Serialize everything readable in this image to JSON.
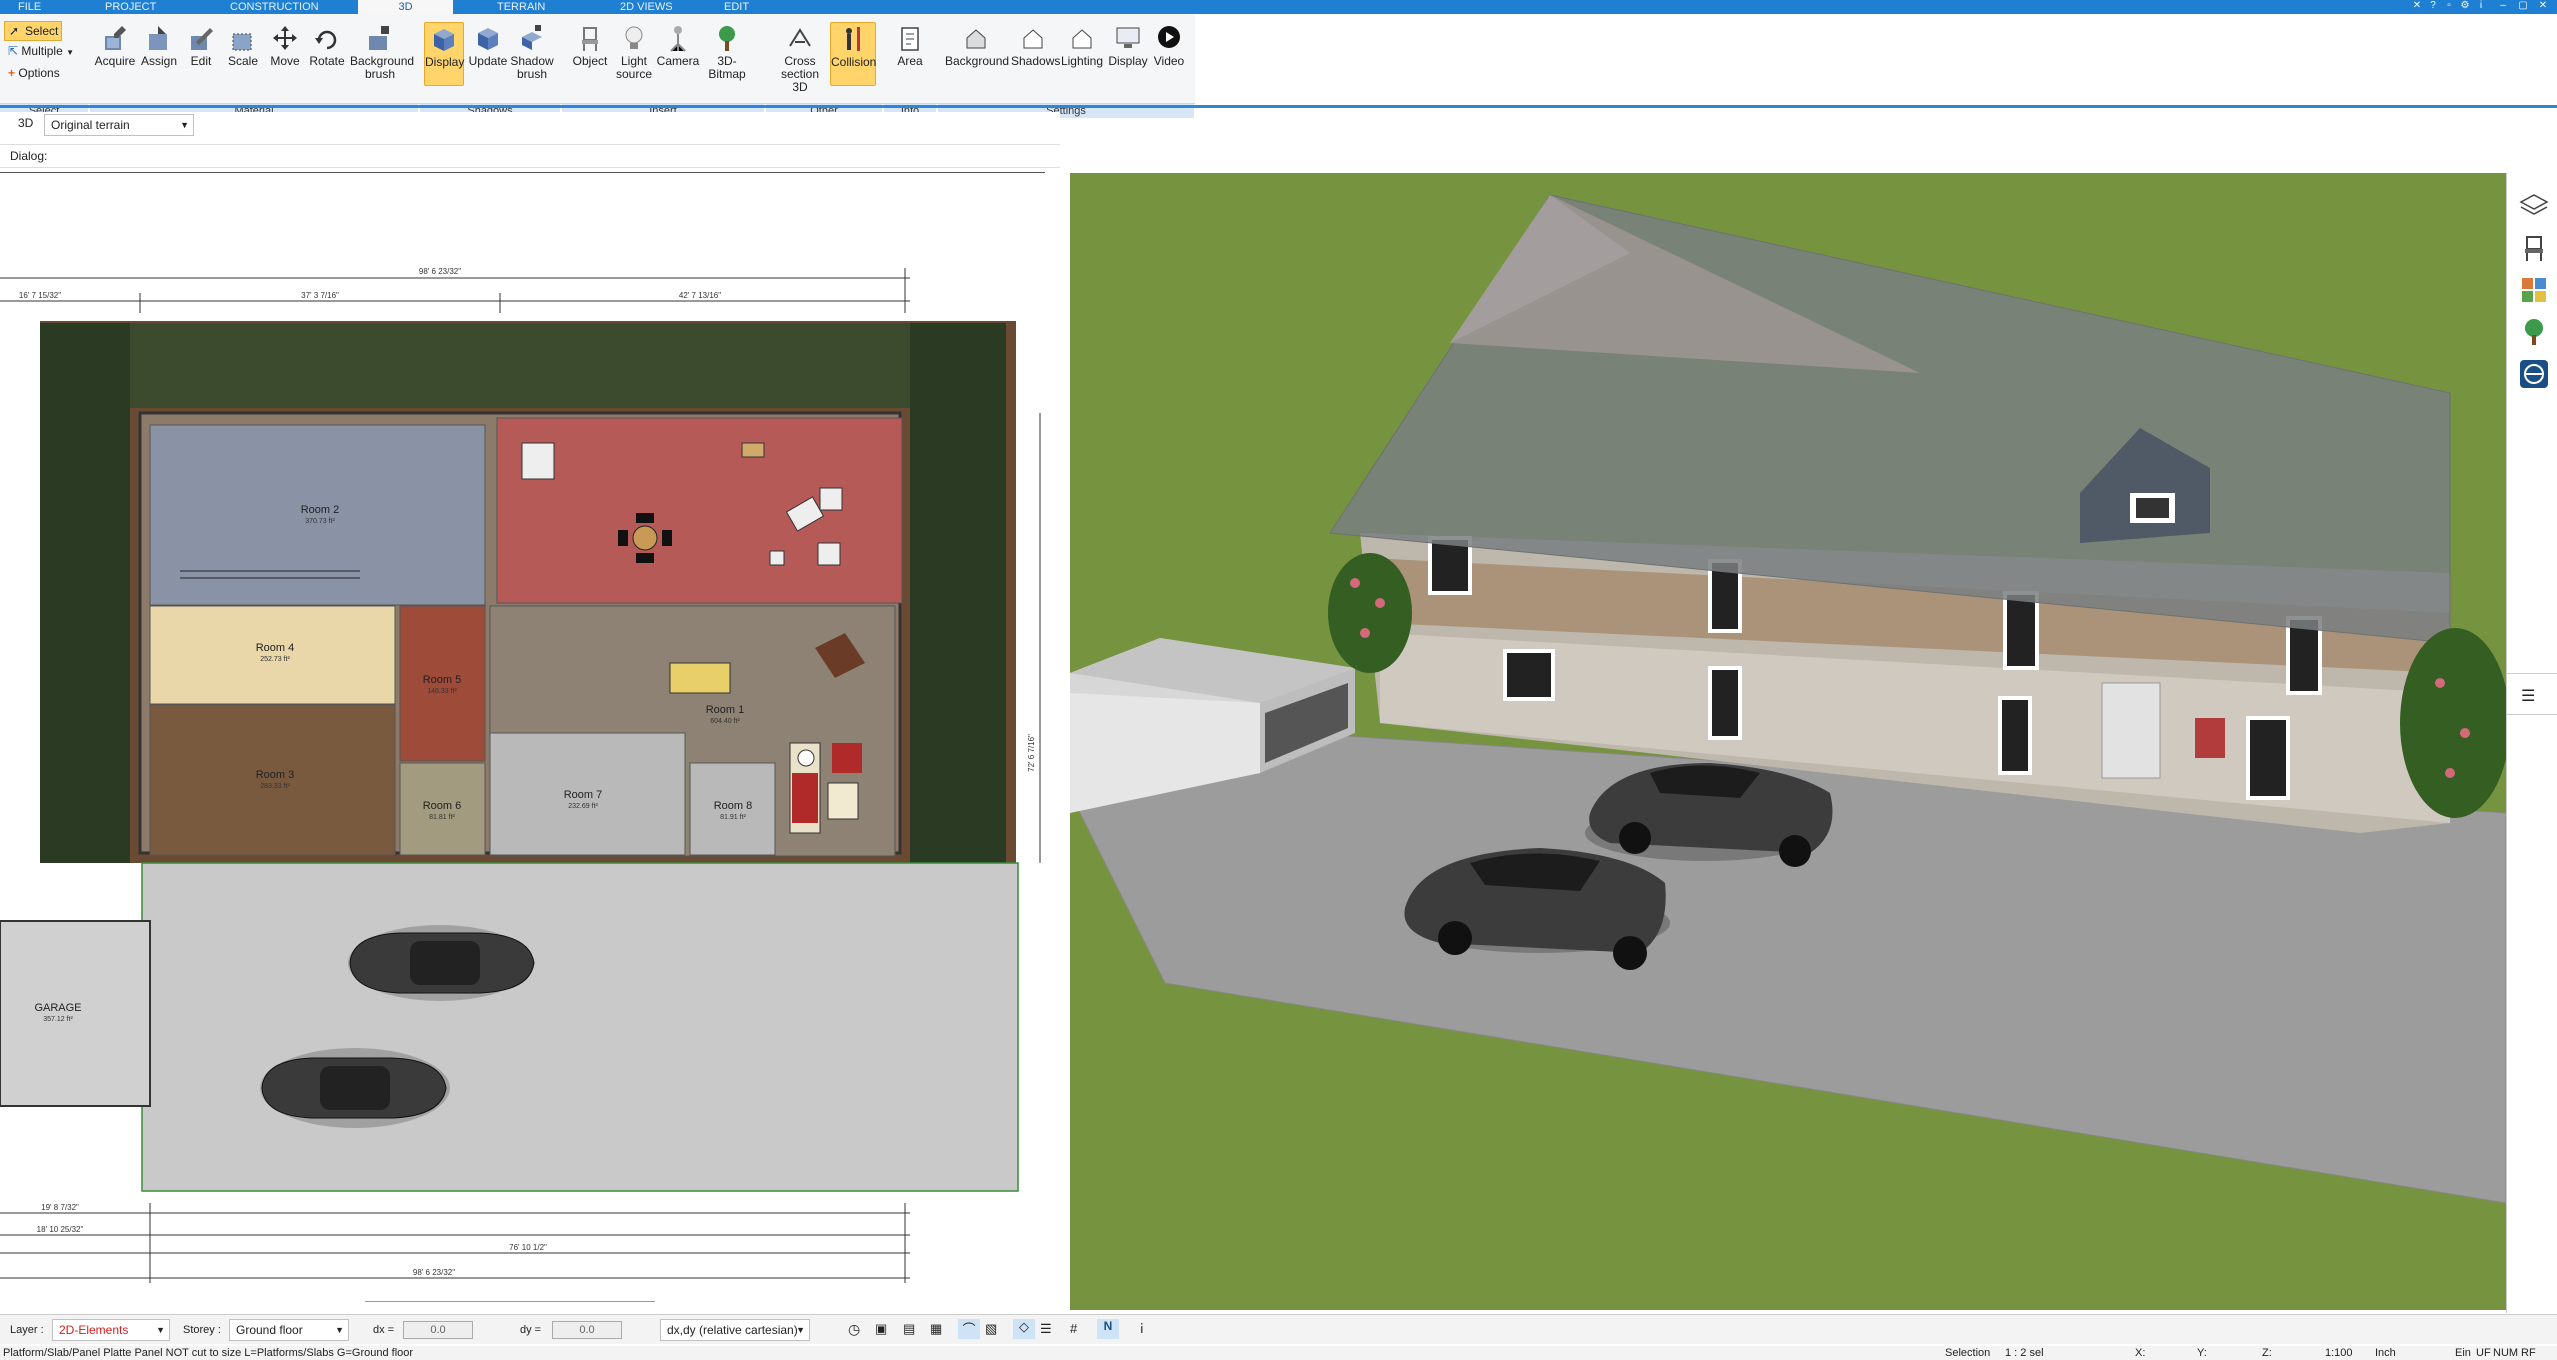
{
  "tabs": [
    {
      "label": "FILE"
    },
    {
      "label": "PROJECT"
    },
    {
      "label": "CONSTRUCTION"
    },
    {
      "label": "3D"
    },
    {
      "label": "TERRAIN"
    },
    {
      "label": "2D VIEWS"
    },
    {
      "label": "EDIT"
    }
  ],
  "ribbon": {
    "select_label": "Select",
    "multiple_label": "Multiple",
    "options_label": "Options",
    "buttons": [
      {
        "label": "Acquire"
      },
      {
        "label": "Assign"
      },
      {
        "label": "Edit"
      },
      {
        "label": "Scale"
      },
      {
        "label": "Move"
      },
      {
        "label": "Rotate"
      },
      {
        "label": "Background brush"
      },
      {
        "label": "Display"
      },
      {
        "label": "Update"
      },
      {
        "label": "Shadow brush"
      },
      {
        "label": "Object"
      },
      {
        "label": "Light source"
      },
      {
        "label": "Camera"
      },
      {
        "label": "3D-Bitmap"
      },
      {
        "label": "Cross section 3D"
      },
      {
        "label": "Collision"
      },
      {
        "label": "Area"
      },
      {
        "label": "Background"
      },
      {
        "label": "Shadows"
      },
      {
        "label": "Lighting"
      },
      {
        "label": "Display"
      },
      {
        "label": "Video"
      }
    ],
    "groups": [
      {
        "label": "Select"
      },
      {
        "label": "Material"
      },
      {
        "label": "Shadows"
      },
      {
        "label": "Insert"
      },
      {
        "label": "Other"
      },
      {
        "label": "Info"
      },
      {
        "label": "Settings"
      }
    ]
  },
  "toolbar2": {
    "mode_label": "3D",
    "terrain_value": "Original terrain"
  },
  "dialog": {
    "label": "Dialog:"
  },
  "plan": {
    "rooms": [
      {
        "name": "Room 2",
        "area": "370.73 ft²"
      },
      {
        "name": "Room 4",
        "area": "252.73 ft²"
      },
      {
        "name": "Room 3",
        "area": "283.33 ft²"
      },
      {
        "name": "Room 5",
        "area": "146.33 ft²"
      },
      {
        "name": "Room 6",
        "area": "81.81 ft²"
      },
      {
        "name": "Room 7",
        "area": "232.69 ft²"
      },
      {
        "name": "Room 8",
        "area": "81.91 ft²"
      },
      {
        "name": "Room 1",
        "area": "604.40 ft²"
      },
      {
        "name": "GARAGE",
        "area": "357.12 ft²"
      }
    ],
    "dims": [
      {
        "text": "98' 6 23/32\""
      },
      {
        "text": "37' 3 7/16\""
      },
      {
        "text": "42' 7 13/16\""
      },
      {
        "text": "16' 7 15/32\""
      },
      {
        "text": "76' 10 1/2\""
      },
      {
        "text": "98' 6 23/32\""
      },
      {
        "text": "19' 8 7/32\""
      },
      {
        "text": "18' 10 25/32\""
      },
      {
        "text": "72' 6 7/16\""
      }
    ]
  },
  "status": {
    "layer_label": "Layer :",
    "layer_value": "2D-Elements",
    "storey_label": "Storey :",
    "storey_value": "Ground floor",
    "dx_label": "dx =",
    "dx_value": "0.0",
    "dy_label": "dy =",
    "dy_value": "0.0",
    "coord_mode": "dx,dy (relative cartesian)"
  },
  "bottom": {
    "hint": "Platform/Slab/Panel Platte Panel NOT cut to size L=Platforms/Slabs G=Ground floor",
    "selection": "Selection",
    "sel_count": "1 : 2 sel",
    "x": "X:",
    "y": "Y:",
    "z": "Z:",
    "scale": "1:100",
    "unit": "Inch",
    "ein": "Ein",
    "uf": "UF",
    "num": "NUM",
    "rf": "RF"
  }
}
